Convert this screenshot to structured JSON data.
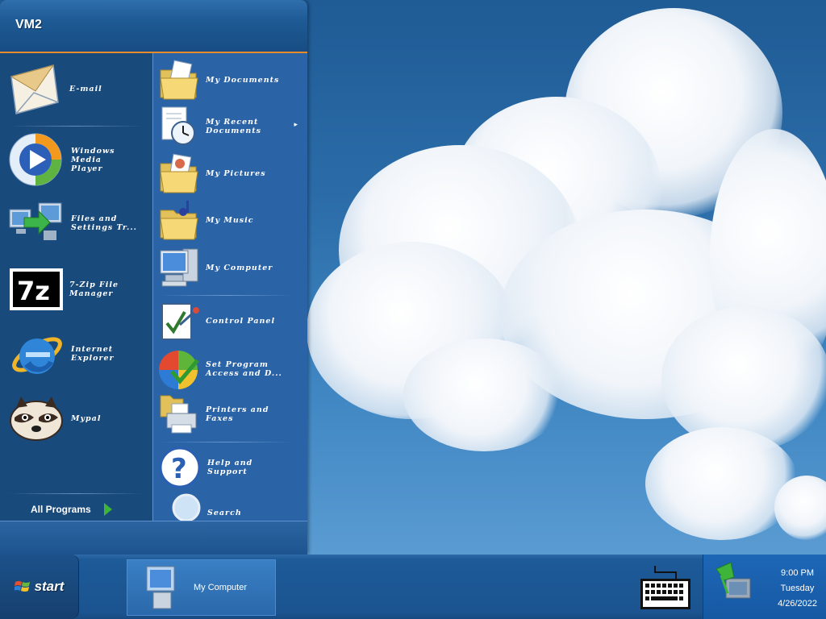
{
  "start_menu": {
    "user_name": "VM2",
    "pinned_items": [
      {
        "label_line1": "E-mail",
        "label_line2": "",
        "icon": "email-envelope-icon"
      },
      {
        "label_line1": "Windows Media",
        "label_line2": "Player",
        "icon": "windows-media-player-icon"
      },
      {
        "label_line1": "Files and",
        "label_line2": "Settings Tr...",
        "icon": "files-settings-transfer-icon"
      },
      {
        "label_line1": "7-Zip File",
        "label_line2": "Manager",
        "icon": "7zip-icon"
      },
      {
        "label_line1": "Internet",
        "label_line2": "Explorer",
        "icon": "internet-explorer-icon"
      },
      {
        "label_line1": "Mypal",
        "label_line2": "",
        "icon": "mypal-raccoon-icon"
      }
    ],
    "all_programs_label": "All Programs",
    "places": [
      {
        "label_line1": "My Documents",
        "label_line2": "",
        "icon": "my-documents-folder-icon"
      },
      {
        "label_line1": "My Recent",
        "label_line2": "Documents",
        "icon": "recent-documents-icon",
        "submenu_arrow": "▸"
      },
      {
        "label_line1": "My Pictures",
        "label_line2": "",
        "icon": "my-pictures-folder-icon"
      },
      {
        "label_line1": "My Music",
        "label_line2": "",
        "icon": "my-music-folder-icon"
      },
      {
        "label_line1": "My Computer",
        "label_line2": "",
        "icon": "my-computer-icon"
      },
      {
        "label_line1": "Control Panel",
        "label_line2": "",
        "icon": "control-panel-icon"
      },
      {
        "label_line1": "Set Program",
        "label_line2": "Access and D...",
        "icon": "set-program-access-icon"
      },
      {
        "label_line1": "Printers and",
        "label_line2": "Faxes",
        "icon": "printers-faxes-icon"
      },
      {
        "label_line1": "Help and",
        "label_line2": "Support",
        "icon": "help-support-icon"
      },
      {
        "label_line1": "Search",
        "label_line2": "",
        "icon": "search-magnifier-icon"
      }
    ]
  },
  "taskbar": {
    "start_label": "start",
    "task_button_label": "My Computer",
    "clock": {
      "time": "9:00 PM",
      "day": "Tuesday",
      "date": "4/26/2022"
    }
  },
  "colors": {
    "accent_orange": "#e78b2b",
    "menu_left": "#184a7c",
    "menu_right": "#2a63a6",
    "taskbar": "#1b5490"
  }
}
